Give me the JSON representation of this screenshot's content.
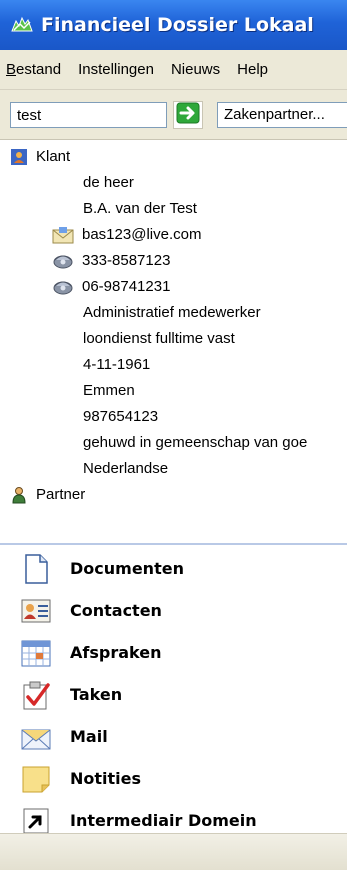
{
  "window": {
    "title": "Financieel Dossier Lokaal"
  },
  "menu": {
    "items": [
      {
        "underlined": "B",
        "rest": "estand"
      },
      {
        "underlined": "",
        "rest": "Instellingen"
      },
      {
        "underlined": "",
        "rest": "Nieuws"
      },
      {
        "underlined": "",
        "rest": "Help"
      }
    ]
  },
  "toolbar": {
    "search_value": "test",
    "partner_select": "Zakenpartner..."
  },
  "tree": {
    "klant_label": "Klant",
    "salutation": "de heer",
    "name": "B.A. van der Test",
    "email": "bas123@live.com",
    "phone1": "333-8587123",
    "phone2": "06-98741231",
    "job": "Administratief medewerker",
    "employment": "loondienst fulltime vast",
    "birthdate": "4-11-1961",
    "city": "Emmen",
    "number": "987654123",
    "marital": "gehuwd in gemeenschap van goe",
    "nationality": "Nederlandse",
    "partner_label": "Partner"
  },
  "nav": {
    "documenten": "Documenten",
    "contacten": "Contacten",
    "afspraken": "Afspraken",
    "taken": "Taken",
    "mail": "Mail",
    "notities": "Notities",
    "intermediair": "Intermediair Domein"
  },
  "icons": {
    "title": "app-logo-icon",
    "go": "arrow-right-icon",
    "klant": "person-card-icon",
    "email": "envelope-icon",
    "phone": "phone-icon",
    "partner": "person-icon",
    "documenten": "document-icon",
    "contacten": "contact-card-icon",
    "afspraken": "calendar-icon",
    "taken": "checkmark-task-icon",
    "mail": "mail-icon",
    "notities": "note-icon",
    "intermediair": "shortcut-arrow-icon"
  },
  "colors": {
    "titlebar": "#1f63d8",
    "menubar": "#ece9d8",
    "go_arrow": "#2fa83a"
  }
}
